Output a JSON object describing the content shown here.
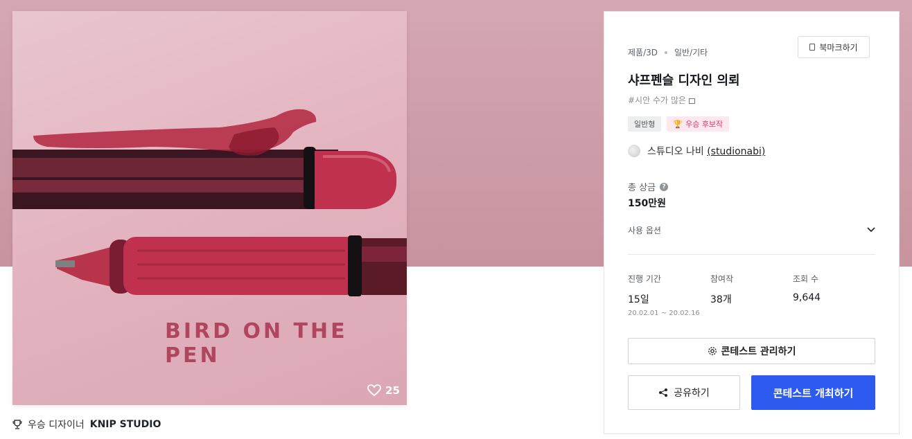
{
  "hero": {
    "image_text": "BIRD ON THE PEN",
    "like_count": "25",
    "winner_prefix": "우승 디자이너",
    "winner_name": "KNIP STUDIO"
  },
  "panel": {
    "category": "제품/3D",
    "subcategory": "일반/기타",
    "bookmark_label": "북마크하기",
    "title": "샤프펜슬 디자인 의뢰",
    "tagline": "#시안 수가 많은 ",
    "badges": {
      "type": "일반형",
      "winner_candidate": "우승 후보작"
    },
    "studio": {
      "name": "스튜디오 나비",
      "handle": "(studionabi)"
    },
    "prize": {
      "label": "총 상금",
      "help": "?",
      "value": "150만원"
    },
    "usage_option_label": "사용 옵션",
    "stats": {
      "period_label": "진행 기간",
      "period_value": "15일",
      "period_dates": "20.02.01 ~ 20.02.16",
      "entries_label": "참여작",
      "entries_value": "38개",
      "views_label": "조회 수",
      "views_value": "9,644"
    },
    "manage_label": "콘테스트 관리하기",
    "share_label": "공유하기",
    "host_label": "콘테스트 개최하기"
  },
  "colors": {
    "accent": "#2d5bf0",
    "hero_bg": "#d4a7b3",
    "pen": "#c0304f",
    "badge_pink_text": "#e2336b"
  },
  "icons": [
    "heart-icon",
    "trophy-icon",
    "bookmark-icon",
    "help-icon",
    "chevron-down-icon",
    "gear-icon",
    "share-icon"
  ]
}
